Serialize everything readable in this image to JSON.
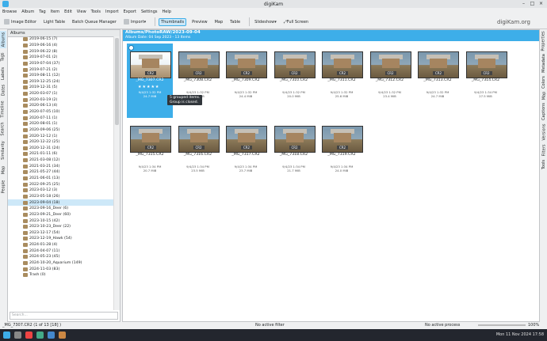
{
  "window": {
    "title": "digiKam"
  },
  "menu": [
    "Browse",
    "Album",
    "Tag",
    "Item",
    "Edit",
    "View",
    "Tools",
    "Import",
    "Export",
    "Settings",
    "Help"
  ],
  "toolbar": {
    "image_editor": "Image Editor",
    "light_table": "Light Table",
    "batch_queue": "Batch Queue Manager",
    "import": "Import",
    "thumbnails": "Thumbnails",
    "preview": "Preview",
    "map": "Map",
    "table": "Table",
    "slideshow": "Slideshow",
    "full_screen": "Full Screen",
    "brand": "digiKam.org"
  },
  "left_tabs": [
    "Albums",
    "Tags",
    "Labels",
    "Dates",
    "Timeline",
    "Search",
    "Similarity",
    "Map",
    "People"
  ],
  "right_tabs": [
    "Properties",
    "Metadata",
    "Colors",
    "Map",
    "Captions",
    "Versions",
    "Filters",
    "Tools"
  ],
  "album_panel": {
    "header": "Albums",
    "search_placeholder": "Search...",
    "albums": [
      "2019-06-15 (7)",
      "2019-06-16 (4)",
      "2019-06-22 (8)",
      "2019-07-01 (2)",
      "2019-07-04 (37)",
      "2019-07-21 (2)",
      "2019-08-11 (12)",
      "2019-12-25 (24)",
      "2019-12-31 (5)",
      "2020-03-07 (1)",
      "2020-03-19 (2)",
      "2020-06-13 (4)",
      "2020-07-05 (10)",
      "2020-07-11 (1)",
      "2020-08-01 (1)",
      "2020-09-06 (25)",
      "2020-12-12 (1)",
      "2020-12-22 (25)",
      "2020-12-31 (24)",
      "2021-01-11 (6)",
      "2021-03-08 (12)",
      "2021-03-21 (34)",
      "2021-05-27 (44)",
      "2021-06-01 (13)",
      "2022-09-25 (25)",
      "2023-03-12 (3)",
      "2023-05-18 (26)",
      "2023-09-04 (18)",
      "2023-09-16_Deer (6)",
      "2023-09-21_Deer (60)",
      "2023-10-15 (42)",
      "2023-10-23_Deer (22)",
      "2023-12-17 (54)",
      "2023-12-19_Hawk (54)",
      "2024-01-28 (4)",
      "2024-04-07 (11)",
      "2024-05-23 (45)",
      "2024-10-20_Aquarium (149)",
      "2024-11-03 (83)",
      "Trash (0)"
    ],
    "selected_index": 27
  },
  "main": {
    "path": "Albums/PhotoRAW/2023-09-04",
    "subtitle": "Album Date: 04 Sep 2023 - 13 Items",
    "tooltip_l1": "5 grouped items.",
    "tooltip_l2": "Group is closed.",
    "items": [
      {
        "name": "_MG_7307.CR2",
        "date": "9/4/23 1:32 PM",
        "size": "24.7 MiB",
        "stars": "★★★★★",
        "selected": true
      },
      {
        "name": "_MG_7308.CR2",
        "date": "9/4/23 1:32 PM",
        "size": "24.4 MiB"
      },
      {
        "name": "_MG_7309.CR2",
        "date": "9/4/23 1:32 PM",
        "size": "24.4 MiB"
      },
      {
        "name": "_MG_7310.CR2",
        "date": "9/4/23 1:32 PM",
        "size": "20.0 MiB"
      },
      {
        "name": "_MG_7311.CR2",
        "date": "9/4/23 1:32 PM",
        "size": "25.6 MiB"
      },
      {
        "name": "_MG_7312.CR2",
        "date": "9/4/23 1:32 PM",
        "size": "23.4 MiB"
      },
      {
        "name": "_MG_7313.CR2",
        "date": "9/4/23 1:32 PM",
        "size": "24.7 MiB"
      },
      {
        "name": "_MG_7314.CR2",
        "date": "9/4/23 1:34 PM",
        "size": "27.5 MiB"
      },
      {
        "name": "_MG_7315.CR2",
        "date": "9/4/23 1:34 PM",
        "size": "20.7 MiB"
      },
      {
        "name": "_MG_7316.CR2",
        "date": "9/4/23 1:34 PM",
        "size": "23.5 MiB"
      },
      {
        "name": "_MG_7317.CR2",
        "date": "9/4/23 1:34 PM",
        "size": "23.7 MiB"
      },
      {
        "name": "_MG_7318.CR2",
        "date": "9/4/23 1:34 PM",
        "size": "21.7 MiB"
      },
      {
        "name": "_MG_7319.CR2",
        "date": "9/4/23 1:34 PM",
        "size": "24.0 MiB"
      }
    ]
  },
  "status": {
    "left": "_MG_7307.CR2 (1 of 13 [18] )",
    "center": "No active filter",
    "process": "No active process",
    "zoom": "100%"
  },
  "taskbar": {
    "clock": "Mon 11 Nov 2024 17:58"
  },
  "colors": {
    "accent": "#3daee9",
    "selection": "#cde8f8"
  }
}
